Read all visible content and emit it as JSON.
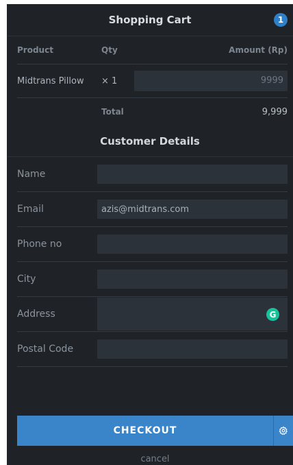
{
  "header": {
    "title": "Shopping Cart",
    "badge_count": "1"
  },
  "cart": {
    "columns": {
      "product": "Product",
      "qty": "Qty",
      "amount": "Amount (Rp)"
    },
    "items": [
      {
        "product": "Midtrans Pillow",
        "qty": "× 1",
        "amount": "9999"
      }
    ],
    "total_label": "Total",
    "total_value": "9,999"
  },
  "customer": {
    "title": "Customer Details",
    "fields": {
      "name": {
        "label": "Name",
        "value": ""
      },
      "email": {
        "label": "Email",
        "value": "azis@midtrans.com"
      },
      "phone": {
        "label": "Phone no",
        "value": ""
      },
      "city": {
        "label": "City",
        "value": ""
      },
      "address": {
        "label": "Address",
        "value": ""
      },
      "postal": {
        "label": "Postal Code",
        "value": ""
      }
    }
  },
  "actions": {
    "checkout_label": "CHECKOUT",
    "cancel_label": "cancel"
  },
  "icons": {
    "badge": "cart-count-badge",
    "grammarly": "grammarly-icon",
    "gear": "gear-icon"
  },
  "colors": {
    "background": "#1f2328",
    "accent": "#3a84c9",
    "badge": "#2f80c7",
    "grammarly": "#15c39a"
  }
}
